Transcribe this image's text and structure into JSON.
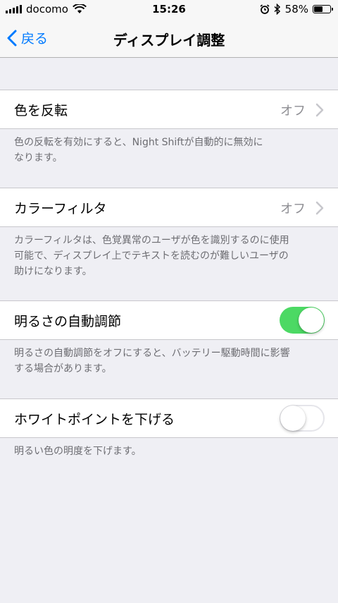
{
  "status_bar": {
    "carrier": "docomo",
    "time": "15:26",
    "battery_percent": "58%",
    "battery_level": 0.58,
    "icons": [
      "signal-icon",
      "wifi-icon",
      "alarm-icon",
      "bluetooth-icon",
      "battery-icon"
    ]
  },
  "nav": {
    "back_label": "戻る",
    "title": "ディスプレイ調整"
  },
  "settings": [
    {
      "label": "色を反転",
      "value": "オフ",
      "footer_line1": "色の反転を有効にすると、Night Shiftが自動的に無効に",
      "footer_line2": "なります。"
    },
    {
      "label": "カラーフィルタ",
      "value": "オフ",
      "footer_line1": "カラーフィルタは、色覚異常のユーザが色を識別するのに使用",
      "footer_line2": "可能で、ディスプレイ上でテキストを読むのが難しいユーザの",
      "footer_line3": "助けになります。"
    },
    {
      "label": "明るさの自動調節",
      "toggle_on": true,
      "footer_line1": "明るさの自動調節をオフにすると、バッテリー駆動時間に影響",
      "footer_line2": "する場合があります。"
    },
    {
      "label": "ホワイトポイントを下げる",
      "toggle_on": false,
      "footer_line1": "明るい色の明度を下げます。"
    }
  ],
  "colors": {
    "accent": "#007aff",
    "toggle_on": "#4cd964",
    "background": "#efeff4"
  }
}
